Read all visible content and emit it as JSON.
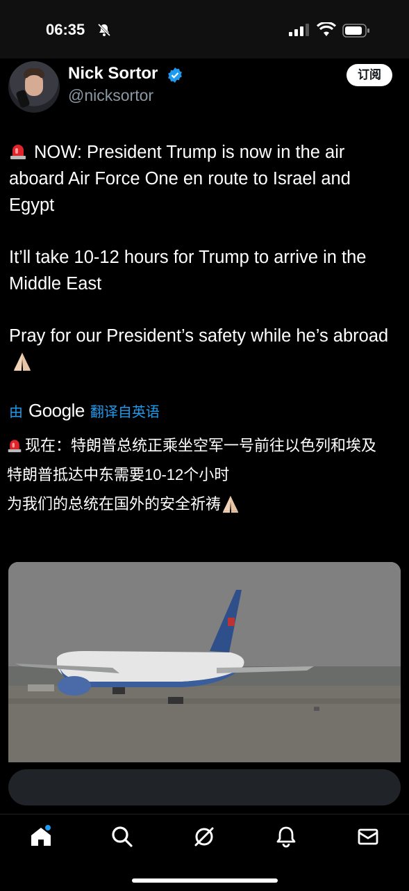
{
  "status": {
    "time": "06:35"
  },
  "author": {
    "name": "Nick Sortor",
    "handle": "@nicksortor",
    "subscribe_label": "订阅"
  },
  "tweet": {
    "line1": "NOW: President Trump is now in the air aboard Air Force One en route to Israel and Egypt",
    "line2": "It’ll take 10-12 hours for Trump to arrive in the Middle East",
    "line3": "Pray for our President’s safety while he’s abroad"
  },
  "translation": {
    "by": "由",
    "provider": "Google",
    "from_label": "翻译自英语",
    "line1": "现在：特朗普总统正乘坐空军一号前往以色列和埃及",
    "line2": "特朗普抵达中东需要10-12个小时",
    "line3": "为我们的总统在国外的安全祈祷"
  },
  "tabs": [
    {
      "name": "home",
      "icon": "home-icon"
    },
    {
      "name": "search",
      "icon": "search-icon"
    },
    {
      "name": "grok",
      "icon": "grok-icon"
    },
    {
      "name": "notifications",
      "icon": "bell-icon"
    },
    {
      "name": "messages",
      "icon": "mail-icon"
    }
  ],
  "colors": {
    "accent": "#1d9bf0",
    "background": "#000000",
    "text": "#ffffff",
    "muted": "#8b98a5"
  }
}
